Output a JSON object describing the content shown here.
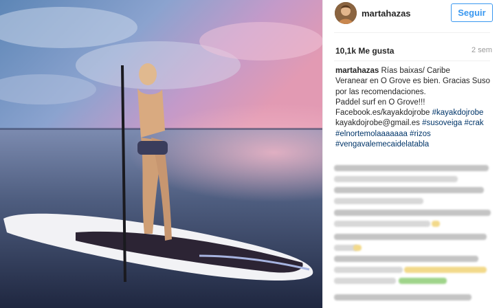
{
  "post": {
    "username": "martahazas",
    "follow_label": "Seguir",
    "likes_text": "10,1k Me gusta",
    "time_ago": "2 sem",
    "caption": {
      "user": "martahazas",
      "line1": " Rías baixas/ Caribe",
      "line2": "Veranear en O Grove es bien. Gracias Suso",
      "line3": "por las recomendaciones.",
      "line4": "Paddel surf en O Grove!!!",
      "line5_plain": "Facebook.es/kayakdojrobe ",
      "line5_tag": "#kayakdojrobe",
      "line6_plain": "kayakdojrobe@gmail.es ",
      "line6_tag1": "#susoveiga",
      "line6_tag2": " #crak",
      "line7_tag1": "#elnortemolaaaaaaa",
      "line7_tag2": " #rizos",
      "line8_tag": "#vengavalemecaidelatabla"
    }
  },
  "icons": {
    "avatar": "user-avatar",
    "photo": "paddle-surf-photo"
  },
  "colors": {
    "accent": "#3897f0",
    "hashtag": "#003569",
    "text": "#262626",
    "muted": "#999999"
  }
}
